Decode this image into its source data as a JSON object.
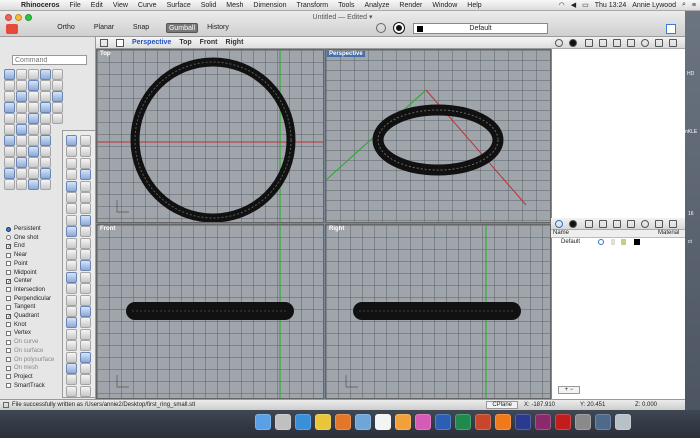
{
  "menubar": {
    "items": [
      "Rhinoceros",
      "File",
      "Edit",
      "View",
      "Curve",
      "Surface",
      "Solid",
      "Mesh",
      "Dimension",
      "Transform",
      "Tools",
      "Analyze",
      "Render",
      "Window",
      "Help"
    ],
    "clock": "Thu 13:24",
    "user": "Annie Lywood"
  },
  "window": {
    "title": "Untitled — Edited ▾",
    "modes": [
      "Ortho",
      "Planar",
      "Snap",
      "Gumball",
      "History"
    ],
    "layer": "Default"
  },
  "viewtabs": [
    "Perspective",
    "Top",
    "Front",
    "Right"
  ],
  "command": {
    "placeholder": "Command"
  },
  "osnap": [
    {
      "label": "Persistent",
      "type": "radio",
      "on": true
    },
    {
      "label": "One shot",
      "type": "radio",
      "on": false
    },
    {
      "label": "End",
      "type": "check",
      "on": true
    },
    {
      "label": "Near",
      "type": "check",
      "on": false
    },
    {
      "label": "Point",
      "type": "check",
      "on": false
    },
    {
      "label": "Midpoint",
      "type": "check",
      "on": false
    },
    {
      "label": "Center",
      "type": "check",
      "on": true
    },
    {
      "label": "Intersection",
      "type": "check",
      "on": false
    },
    {
      "label": "Perpendicular",
      "type": "check",
      "on": false
    },
    {
      "label": "Tangent",
      "type": "check",
      "on": false
    },
    {
      "label": "Quadrant",
      "type": "check",
      "on": true
    },
    {
      "label": "Knot",
      "type": "check",
      "on": false
    },
    {
      "label": "Vertex",
      "type": "check",
      "on": false
    },
    {
      "label": "On curve",
      "type": "check",
      "on": false,
      "dim": true
    },
    {
      "label": "On surface",
      "type": "check",
      "on": false,
      "dim": true
    },
    {
      "label": "On polysurface",
      "type": "check",
      "on": false,
      "dim": true
    },
    {
      "label": "On mesh",
      "type": "check",
      "on": false,
      "dim": true
    },
    {
      "label": "Project",
      "type": "check",
      "on": false
    },
    {
      "label": "SmartTrack",
      "type": "check",
      "on": false
    }
  ],
  "viewports": {
    "top": "Top",
    "perspective": "Perspective",
    "front": "Front",
    "right": "Right"
  },
  "layers": {
    "col_name": "Name",
    "col_material": "Material",
    "row_name": "Default",
    "add_label": "+ −"
  },
  "status": {
    "message": "File successfully written as /Users/annie2/Desktop/first_ring_small.stl",
    "cplane": "CPlane",
    "x": "X: -187.910",
    "y": "Y: 20.451",
    "z": "Z: 0.000"
  },
  "desktop": {
    "labels": [
      "HD",
      "nKLE",
      "16",
      "ct"
    ]
  },
  "dock_icons": [
    "finder-icon",
    "launchpad-icon",
    "safari-icon",
    "chrome-icon",
    "firefox-icon",
    "mail-icon",
    "calendar-icon",
    "photos-icon",
    "itunes-icon",
    "word-icon",
    "excel-icon",
    "powerpoint-icon",
    "illustrator-icon",
    "photoshop-icon",
    "indesign-icon",
    "acrobat-icon",
    "preferences-icon",
    "rhino-icon",
    "trash-icon"
  ],
  "colors": {
    "grid": "#9fa5ab",
    "x_axis": "#b33",
    "y_axis": "#2a2",
    "selection": "#4a6fa8"
  }
}
